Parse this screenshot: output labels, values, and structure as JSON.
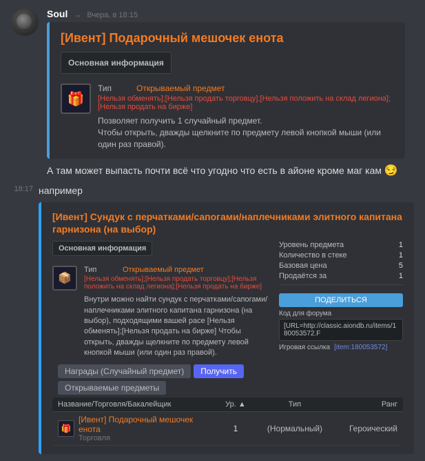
{
  "message1": {
    "username": "Soul",
    "forward_indicator": "→",
    "timestamp": "Вчера, в 18:15",
    "embed": {
      "title": "[Ивент] Подарочный мешочек енота",
      "info_label": "Основная информация",
      "item_type_label": "Тип",
      "item_type_value": "Открываемый предмет",
      "restrictions": "[Нельзя обменять];[Нельзя продать торговцу];[Нельзя положить на склад легиона];[Нельзя продать на бирже]",
      "description_line1": "Позволяет получить 1 случайный предмет.",
      "description_line2": "Чтобы открыть, дважды щелкните по предмету левой кнопкой мыши (или один раз правой)."
    }
  },
  "message2": {
    "text1": "А там  может выпасть почти всё что угодно  что есть в айоне кроме маг кам",
    "emoji": "😏",
    "text2": "например",
    "timestamp": "18:17"
  },
  "embed2": {
    "title": "[Ивент] Сундук с перчатками/сапогами/наплечниками элитного капитана гарнизона (на выбор)",
    "info_label": "Основная информация",
    "item_type_label": "Тип",
    "item_type_value": "Открываемый предмет",
    "restrictions": "[Нельзя обменять];[Нельзя продать торговцу];[Нельзя положить на склад легиона];[Нельзя продать на бирже]",
    "description": "Внутри можно найти сундук с перчатками/сапогами/наплечниками элитного капитана гарнизона (на выбор), подходящими вашей расе [Нельзя обменять];[Нельзя продать на бирже] Чтобы открыть, дважды щелкните по предмету левой кнопкой мыши (или один раз правой).",
    "level_label": "Уровень предмета",
    "level_value": "1",
    "count_label": "Количество в стеке",
    "count_value": "1",
    "base_label": "Базовая цена",
    "base_value": "5",
    "sell_label": "Продаётся за",
    "sell_value": "1",
    "share_btn": "ПОДЕЛИТЬСЯ",
    "forum_code_label": "Код для форума",
    "forum_code_value": "[URL=http://classic.aiondb.ru/items/180053572.F",
    "game_link_label": "Игровая ссылка",
    "game_link_value": "[item:180053572]"
  },
  "tabs": {
    "tab1_label": "Награды (Случайный предмет)",
    "tab2_label": "Получить"
  },
  "subtab": {
    "label": "Открываемые предметы"
  },
  "table": {
    "col1": "Название/Торговля/Бакалейщик",
    "col2": "Ур. ▲",
    "col3": "Тип",
    "col4": "Ранг",
    "rows": [
      {
        "name": "[Ивент] Подарочный мешочек енота",
        "sub": "Торговля",
        "level": "1",
        "type": "(Нормальный)",
        "rank": "Героический"
      }
    ]
  }
}
